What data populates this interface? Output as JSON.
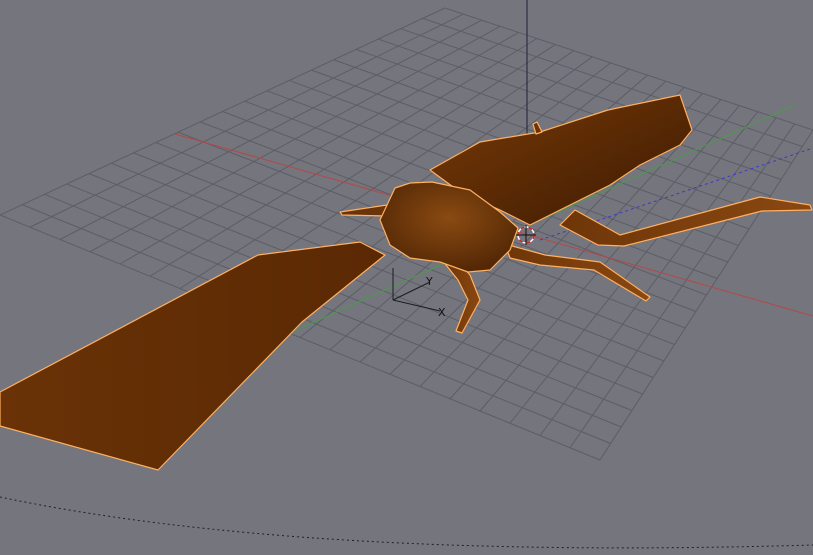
{
  "viewport": {
    "background": "#75757e",
    "object_color": "#5a2a04",
    "object_highlight": "#8a4a10",
    "selection_outline": "#ffb060",
    "grid_color": "#5d5d66",
    "axis_x_color": "#b44848",
    "axis_y_color": "#4b9a4b",
    "axis_z_color": "#20203a"
  },
  "manipulator": {
    "label_x": "X",
    "label_y": "Y"
  },
  "icons": {
    "cursor": "3d-cursor-icon",
    "manipulator": "transform-manipulator-icon"
  }
}
